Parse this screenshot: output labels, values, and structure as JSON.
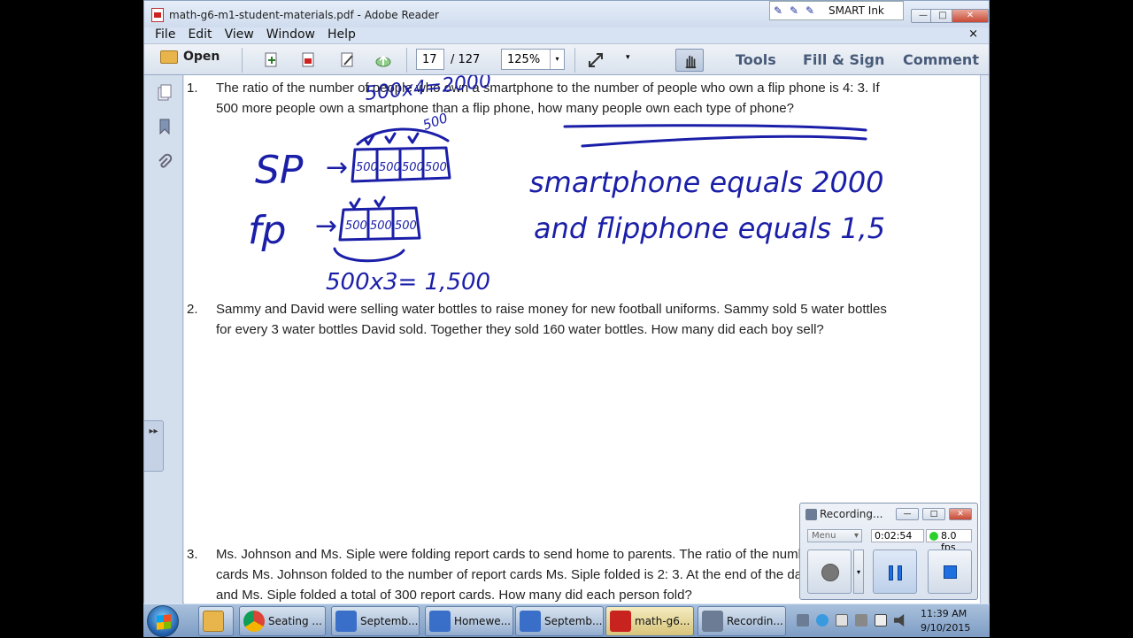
{
  "window": {
    "title": "math-g6-m1-student-materials.pdf - Adobe Reader",
    "smart_ink": "SMART Ink",
    "controls": {
      "minimize": "—",
      "restore": "□",
      "close": "✕"
    }
  },
  "menu": {
    "items": [
      "File",
      "Edit",
      "View",
      "Window",
      "Help"
    ],
    "close": "×"
  },
  "toolbar": {
    "open_label": "Open",
    "page_current": "17",
    "page_total": "/ 127",
    "zoom": "125%",
    "zoom_arrow": "▾",
    "more_arrow": "▾",
    "tools": "Tools",
    "fill_sign": "Fill & Sign",
    "comment": "Comment"
  },
  "left_panel": {
    "collapse_tab": "▸▸"
  },
  "document": {
    "problems": [
      {
        "number": "1.",
        "lines": [
          "The ratio of the number of people who own a smartphone to the number of people who own a flip phone is 4: 3.  If",
          "500 more people own a smartphone than a flip phone, how many people own each type of phone?"
        ]
      },
      {
        "number": "2.",
        "lines": [
          "Sammy and David were selling water bottles to raise money for new football uniforms.  Sammy sold 5 water bottles",
          "for every 3 water bottles David sold.  Together they sold 160 water bottles.  How many did each boy sell?"
        ]
      },
      {
        "number": "3.",
        "lines": [
          "Ms. Johnson and Ms. Siple were folding report cards to send home to parents.  The ratio of the number of report",
          "cards Ms. Johnson folded to the number of report cards Ms. Siple folded is 2: 3.  At the end of the day, Ms. Johnson",
          "and Ms. Siple folded a total of 300 report cards.  How many did each person fold?"
        ]
      }
    ],
    "ink": {
      "sp": "SP",
      "fp": "fp",
      "arrow": "→",
      "box_value": "500",
      "top_calc": "500x4=2000",
      "bottom_calc": "500x3= 1,500",
      "answer_line1": "smartphone equals 2000",
      "answer_line2": "and flipphone equals 1,5"
    }
  },
  "recorder": {
    "title": "Recording...",
    "menu": "Menu",
    "menu_arrow": "▾",
    "time": "0:02:54",
    "fps": "8.0 fps"
  },
  "taskbar": {
    "items": [
      {
        "label": "Seating ...",
        "color": "#2e9a3e"
      },
      {
        "label": "Septemb...",
        "color": "#3a6fc9"
      },
      {
        "label": "Homewe...",
        "color": "#3a6fc9"
      },
      {
        "label": "Septemb...",
        "color": "#3a6fc9"
      },
      {
        "label": "math-g6...",
        "color": "#c8231f"
      },
      {
        "label": "Recordin...",
        "color": "#6b7c94"
      }
    ],
    "clock_time": "11:39 AM",
    "clock_date": "9/10/2015"
  }
}
